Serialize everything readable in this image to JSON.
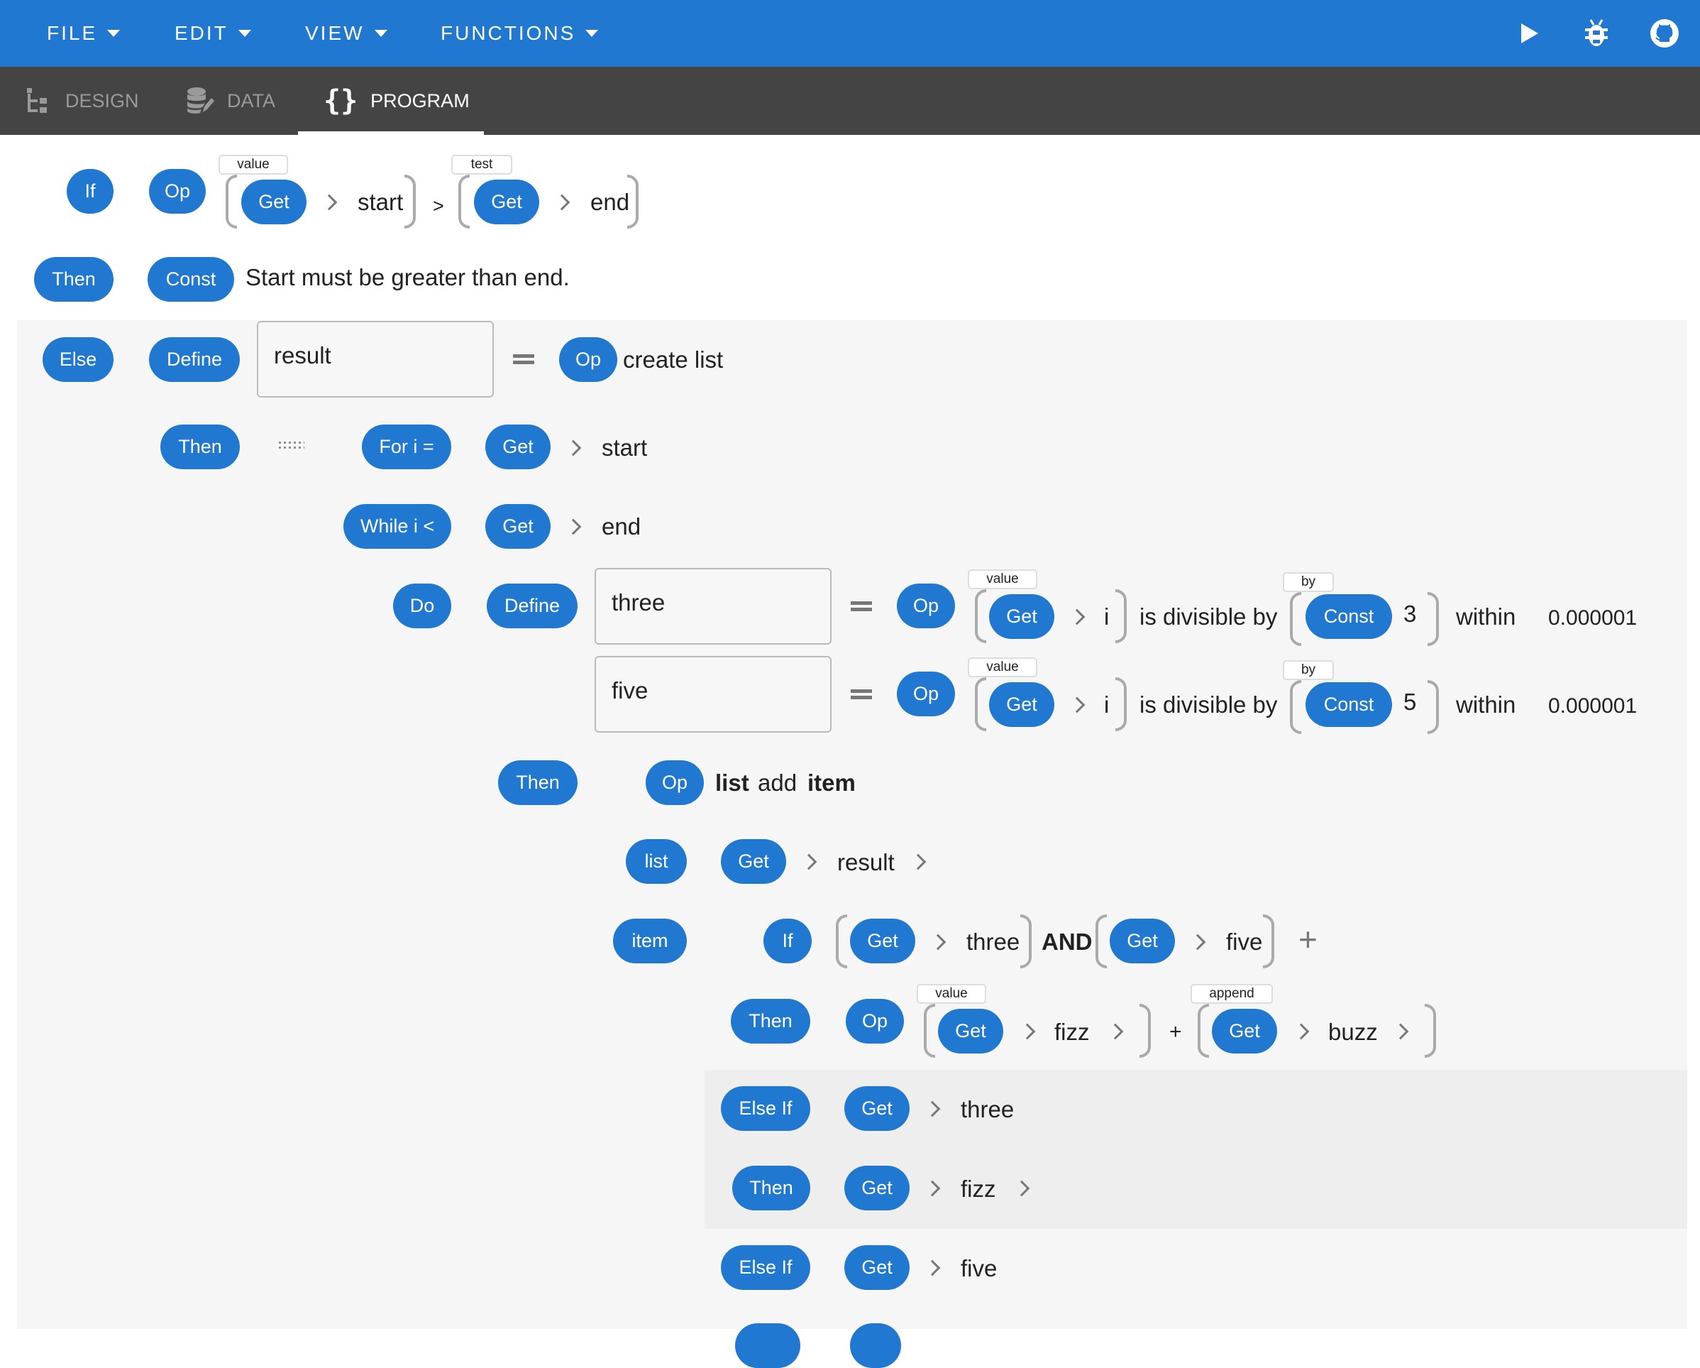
{
  "menubar": {
    "items": [
      {
        "label": "FILE"
      },
      {
        "label": "EDIT"
      },
      {
        "label": "VIEW"
      },
      {
        "label": "FUNCTIONS"
      }
    ],
    "icons": [
      "play-icon",
      "bug-icon",
      "github-icon"
    ]
  },
  "tabs": [
    {
      "label": "DESIGN",
      "icon": "tree-icon",
      "active": false
    },
    {
      "label": "DATA",
      "icon": "database-icon",
      "active": false
    },
    {
      "label": "PROGRAM",
      "icon": "braces-icon",
      "active": true
    }
  ],
  "program": {
    "if1": {
      "kw": "If",
      "op": "Op",
      "left_tag": "value",
      "left_get": "Get",
      "left_var": "start",
      "operator": ">",
      "right_tag": "test",
      "right_get": "Get",
      "right_var": "end"
    },
    "then1": {
      "kw": "Then",
      "const": "Const",
      "text": "Start must be greater than end."
    },
    "else1": {
      "kw": "Else",
      "define": "Define",
      "name": "result",
      "op": "Op",
      "op_text": "create list"
    },
    "then2": {
      "kw": "Then",
      "for_kw": "For i =",
      "get": "Get",
      "var": "start"
    },
    "while": {
      "kw": "While i <",
      "get": "Get",
      "var": "end"
    },
    "do": {
      "kw": "Do",
      "define": "Define",
      "defs": [
        {
          "name": "three",
          "op": "Op",
          "value_tag": "value",
          "get": "Get",
          "var": "i",
          "text": "is divisible by",
          "by_tag": "by",
          "const": "Const",
          "num": "3",
          "within": "within",
          "tol": "0.000001"
        },
        {
          "name": "five",
          "op": "Op",
          "value_tag": "value",
          "get": "Get",
          "var": "i",
          "text": "is divisible by",
          "by_tag": "by",
          "const": "Const",
          "num": "5",
          "within": "within",
          "tol": "0.000001"
        }
      ]
    },
    "then3": {
      "kw": "Then",
      "op": "Op",
      "t1": "list",
      "t2": "add",
      "t3": "item"
    },
    "list_arg": {
      "kw": "list",
      "get": "Get",
      "var": "result"
    },
    "item_arg": {
      "kw": "item",
      "if": "If",
      "get1": "Get",
      "var1": "three",
      "and": "AND",
      "get2": "Get",
      "var2": "five"
    },
    "then4": {
      "kw": "Then",
      "op": "Op",
      "value_tag": "value",
      "get1": "Get",
      "var1": "fizz",
      "plus": "+",
      "append_tag": "append",
      "get2": "Get",
      "var2": "buzz"
    },
    "elseif1": {
      "kw": "Else If",
      "get": "Get",
      "var": "three"
    },
    "then5": {
      "kw": "Then",
      "get": "Get",
      "var": "fizz"
    },
    "elseif2": {
      "kw": "Else If",
      "get": "Get",
      "var": "five"
    }
  }
}
